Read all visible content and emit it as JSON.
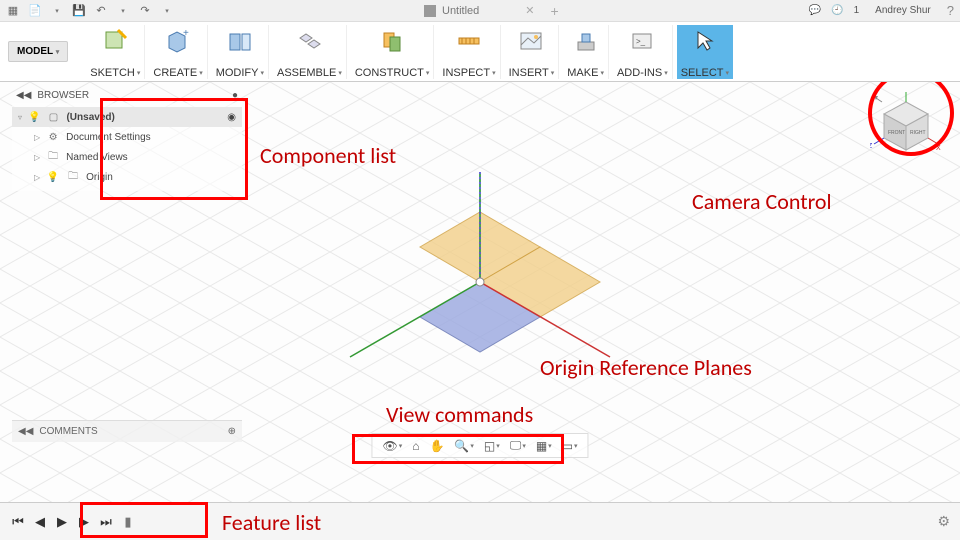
{
  "titlebar": {
    "doc_title": "Untitled",
    "notif_count": "1",
    "user_name": "Andrey Shur"
  },
  "ribbon": {
    "model_label": "MODEL",
    "groups": [
      {
        "label": "SKETCH"
      },
      {
        "label": "CREATE"
      },
      {
        "label": "MODIFY"
      },
      {
        "label": "ASSEMBLE"
      },
      {
        "label": "CONSTRUCT"
      },
      {
        "label": "INSPECT"
      },
      {
        "label": "INSERT"
      },
      {
        "label": "MAKE"
      },
      {
        "label": "ADD-INS"
      },
      {
        "label": "SELECT"
      }
    ]
  },
  "browser": {
    "title": "BROWSER",
    "root_label": "(Unsaved)",
    "items": [
      {
        "label": "Document Settings"
      },
      {
        "label": "Named Views"
      },
      {
        "label": "Origin"
      }
    ]
  },
  "viewcube": {
    "front": "FRONT",
    "right": "RIGHT",
    "x": "X",
    "y": "Y",
    "z": "Z"
  },
  "comments_label": "COMMENTS",
  "annotations": {
    "component_list": "Component list",
    "camera_control": "Camera Control",
    "origin_planes": "Origin Reference Planes",
    "view_commands": "View commands",
    "feature_list": "Feature list"
  }
}
